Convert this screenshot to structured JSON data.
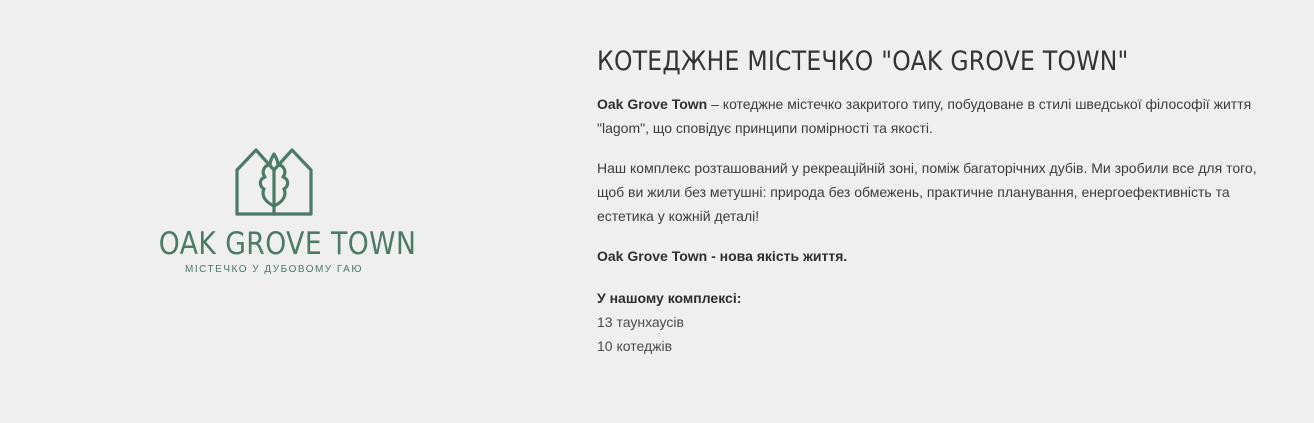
{
  "logo": {
    "wordmark": "OAK GROVE TOWN",
    "tagline": "МІСТЕЧКО У ДУБОВОМУ ГАЮ",
    "icon": "house-oak-leaf-icon",
    "color": "#4b7a66"
  },
  "about": {
    "title": "КОТЕДЖНЕ МІСТЕЧКО \"OAK GROVE TOWN\"",
    "intro_brand": "Oak Grove Town",
    "intro_text": " – котеджне містечко закритого типу, побудоване в стилі шведської філософії життя \"lagom\", що сповідує принципи помірності та якості.",
    "paragraph2": "Наш комплекс розташований у рекреаційній зоні, поміж багаторічних дубів. Ми зробили все для того, щоб ви жили без метушні: природа без обмежень, практичне планування, енергоефективність та естетика у кожній деталі!",
    "tagline": "Oak Grove Town - нова якість життя.",
    "complex_heading": "У нашому комплексі:",
    "complex_items": [
      "13 таунхаусів",
      "10 котеджів"
    ]
  }
}
